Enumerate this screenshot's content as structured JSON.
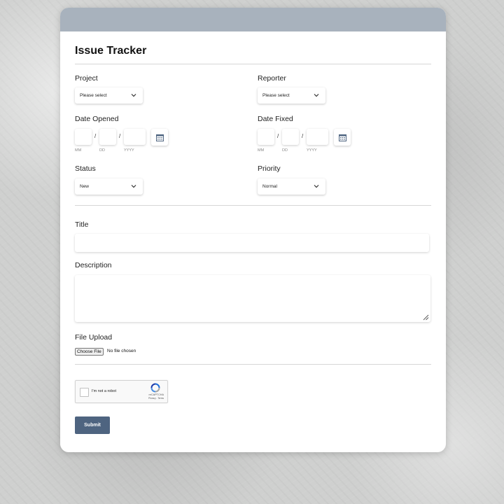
{
  "form": {
    "title": "Issue Tracker",
    "project": {
      "label": "Project",
      "value": "Please select"
    },
    "reporter": {
      "label": "Reporter",
      "value": "Please select"
    },
    "date_opened": {
      "label": "Date Opened",
      "hint_mm": "MM",
      "hint_dd": "DD",
      "hint_yyyy": "YYYY",
      "separator": "/"
    },
    "date_fixed": {
      "label": "Date Fixed",
      "hint_mm": "MM",
      "hint_dd": "DD",
      "hint_yyyy": "YYYY",
      "separator": "/"
    },
    "status": {
      "label": "Status",
      "value": "New"
    },
    "priority": {
      "label": "Priority",
      "value": "Normal"
    },
    "title_field": {
      "label": "Title",
      "value": ""
    },
    "description": {
      "label": "Description",
      "value": ""
    },
    "file_upload": {
      "label": "File Upload",
      "button_label": "Choose File",
      "status_text": "No file chosen"
    },
    "captcha": {
      "text": "I'm not a robot",
      "brand": "reCAPTCHA",
      "terms": "Privacy - Terms"
    },
    "submit_label": "Submit"
  },
  "colors": {
    "header": "#a8b2bd",
    "submit": "#4e6480",
    "calendar_icon": "#4e6480",
    "captcha_blue": "#1c6cd8"
  },
  "icons": {
    "select_arrow": "chevron-down-icon",
    "date_picker": "calendar-icon",
    "textarea_resize": "resize-handle-icon",
    "captcha_logo": "recaptcha-logo-icon"
  }
}
